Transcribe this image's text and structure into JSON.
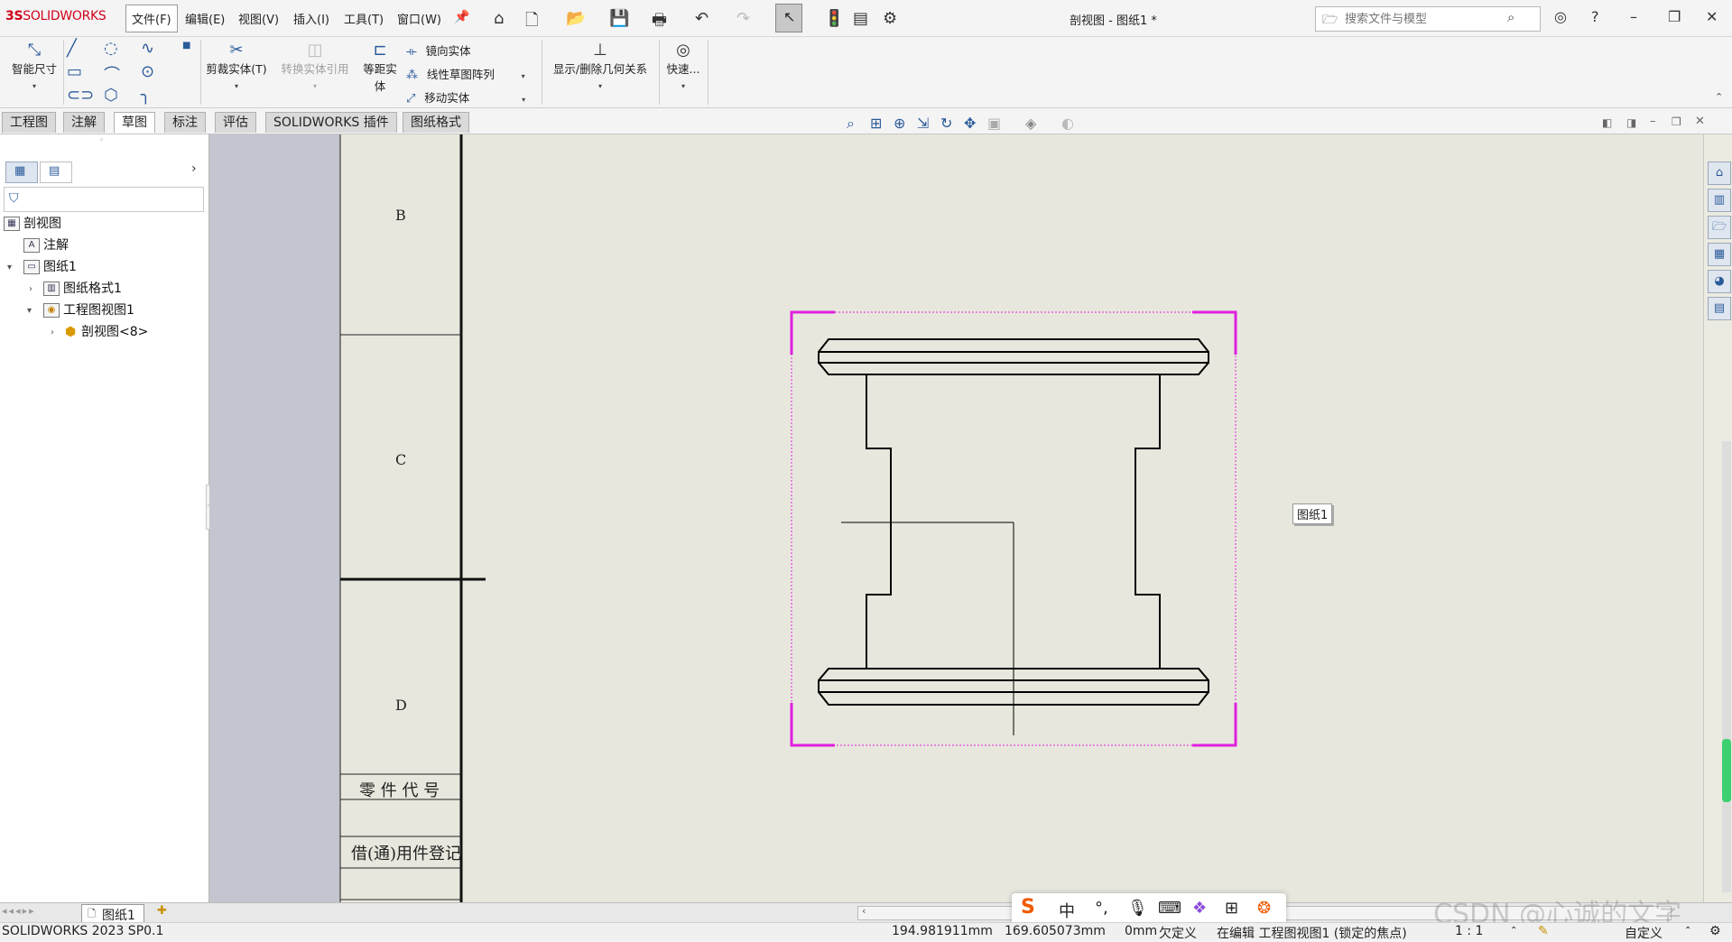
{
  "titlebar": {
    "logo_ds": "3S",
    "logo_text": "SOLIDWORKS",
    "menus": [
      "文件(F)",
      "编辑(E)",
      "视图(V)",
      "插入(I)",
      "工具(T)",
      "窗口(W)"
    ],
    "doc_title": "剖视图 - 图纸1 *",
    "search_placeholder": "搜索文件与模型"
  },
  "ribbon": {
    "smart_dimension": "智能尺寸",
    "trim_entities": "剪裁实体(T)",
    "convert_entities": "转换实体引用",
    "offset_entities_1": "等距实",
    "offset_entities_2": "体",
    "mirror_entities": "镜向实体",
    "linear_pattern": "线性草图阵列",
    "move_entities": "移动实体",
    "show_relations": "显示/删除几何关系",
    "quick_snaps": "快速..."
  },
  "tabs": [
    "工程图",
    "注解",
    "草图",
    "标注",
    "评估",
    "SOLIDWORKS 插件",
    "图纸格式"
  ],
  "active_tab": "草图",
  "tree": {
    "root": "剖视图",
    "annotations": "注解",
    "sheet": "图纸1",
    "sheet_format": "图纸格式1",
    "drawing_view": "工程图视图1",
    "section_view": "剖视图<8>"
  },
  "drawing": {
    "zone_b": "B",
    "zone_c": "C",
    "zone_d": "D",
    "part_code": "零 件 代 号",
    "borrowed_reg": "借(通)用件登记",
    "sheet_tag": "图纸1"
  },
  "sheet_tab": "图纸1",
  "status": {
    "version": "SOLIDWORKS 2023 SP0.1",
    "x": "194.981911mm",
    "y": "169.605073mm",
    "z": "0mm",
    "define": "欠定义",
    "editing": "在编辑 工程图视图1 (锁定的焦点)",
    "scale": "1 : 1",
    "units": "自定义"
  },
  "ime": {
    "mode": "中"
  },
  "watermark": "CSDN @心诚的文字",
  "colors": {
    "logo_red": "#d0021b",
    "accent_blue": "#2a5a9a",
    "view_border": "#e020e0",
    "canvas_bg": "#e8e7dd"
  }
}
